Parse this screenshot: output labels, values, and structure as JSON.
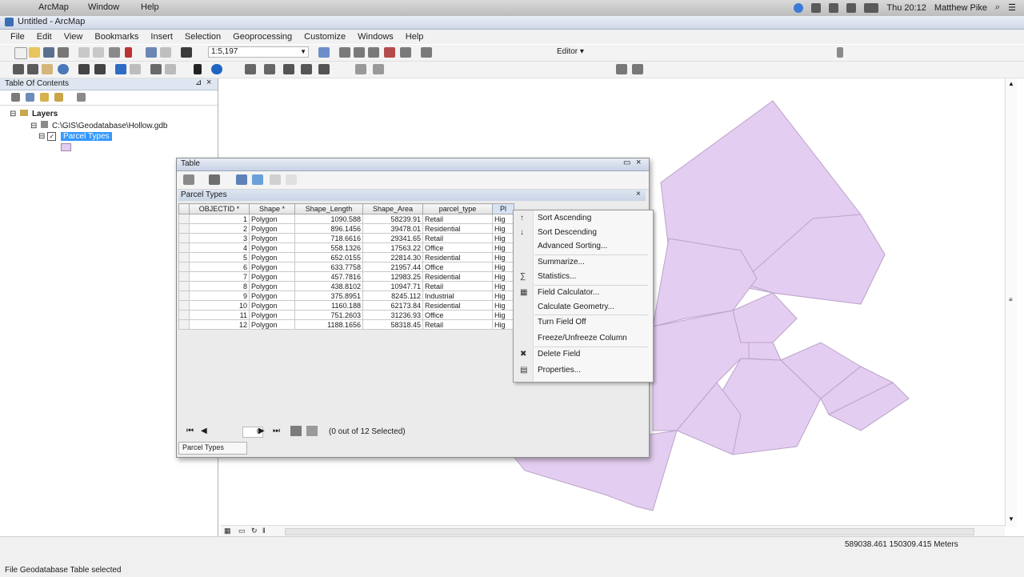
{
  "system_bar": {
    "app_name": "ArcMap",
    "menu_items": [
      "Window",
      "Help"
    ],
    "clock": "Thu 20:12",
    "user": "Matthew Pike"
  },
  "window": {
    "title": "Untitled - ArcMap"
  },
  "menu": [
    "File",
    "Edit",
    "View",
    "Bookmarks",
    "Insert",
    "Selection",
    "Geoprocessing",
    "Customize",
    "Windows",
    "Help"
  ],
  "toolbar": {
    "scale": "1:5,197",
    "editor_label": "Editor ▾"
  },
  "toc": {
    "title": "Table Of Contents",
    "root": "Layers",
    "gdb": "C:\\GIS\\Geodatabase\\Hollow.gdb",
    "layer": "Parcel Types"
  },
  "table_window": {
    "title": "Table",
    "tab_title": "Parcel Types",
    "columns": [
      "OBJECTID *",
      "Shape *",
      "Shape_Length",
      "Shape_Area",
      "parcel_type",
      "Pl"
    ],
    "rows": [
      [
        "1",
        "Polygon",
        "1090.588",
        "58239.91",
        "Retail",
        "Hig"
      ],
      [
        "2",
        "Polygon",
        "896.1456",
        "39478.01",
        "Residential",
        "Hig"
      ],
      [
        "3",
        "Polygon",
        "718.6616",
        "29341.65",
        "Retail",
        "Hig"
      ],
      [
        "4",
        "Polygon",
        "558.1326",
        "17563.22",
        "Office",
        "Hig"
      ],
      [
        "5",
        "Polygon",
        "652.0155",
        "22814.30",
        "Residential",
        "Hig"
      ],
      [
        "6",
        "Polygon",
        "633.7758",
        "21957.44",
        "Office",
        "Hig"
      ],
      [
        "7",
        "Polygon",
        "457.7816",
        "12983.25",
        "Residential",
        "Hig"
      ],
      [
        "8",
        "Polygon",
        "438.8102",
        "10947.71",
        "Retail",
        "Hig"
      ],
      [
        "9",
        "Polygon",
        "375.8951",
        "8245.112",
        "Industrial",
        "Hig"
      ],
      [
        "10",
        "Polygon",
        "1160.188",
        "62173.84",
        "Residential",
        "Hig"
      ],
      [
        "11",
        "Polygon",
        "751.2603",
        "31236.93",
        "Office",
        "Hig"
      ],
      [
        "12",
        "Polygon",
        "1188.1656",
        "58318.45",
        "Retail",
        "Hig"
      ]
    ],
    "page": "0",
    "selection_status": "(0 out of 12 Selected)",
    "bottom_tab": "Parcel Types"
  },
  "context_menu": {
    "items": [
      {
        "label": "Sort Ascending",
        "icon": "sort-ascending-icon"
      },
      {
        "label": "Sort Descending",
        "icon": "sort-descending-icon"
      },
      {
        "label": "Advanced Sorting...",
        "icon": ""
      },
      {
        "label": "Summarize...",
        "icon": ""
      },
      {
        "label": "Statistics...",
        "icon": "statistics-icon"
      },
      {
        "label": "Field Calculator...",
        "icon": "field-calculator-icon"
      },
      {
        "label": "Calculate Geometry...",
        "icon": ""
      },
      {
        "label": "Turn Field Off",
        "icon": ""
      },
      {
        "label": "Freeze/Unfreeze Column",
        "icon": ""
      },
      {
        "label": "Delete Field",
        "icon": "delete-icon"
      },
      {
        "label": "Properties...",
        "icon": "properties-icon"
      }
    ]
  },
  "status": {
    "coordinates": "589038.461  150309.415 Meters",
    "message": "File Geodatabase Table selected"
  },
  "colors": {
    "polygon_fill": "#e3cdf0",
    "polygon_stroke": "#bca4cc",
    "selection": "#3399ff"
  }
}
